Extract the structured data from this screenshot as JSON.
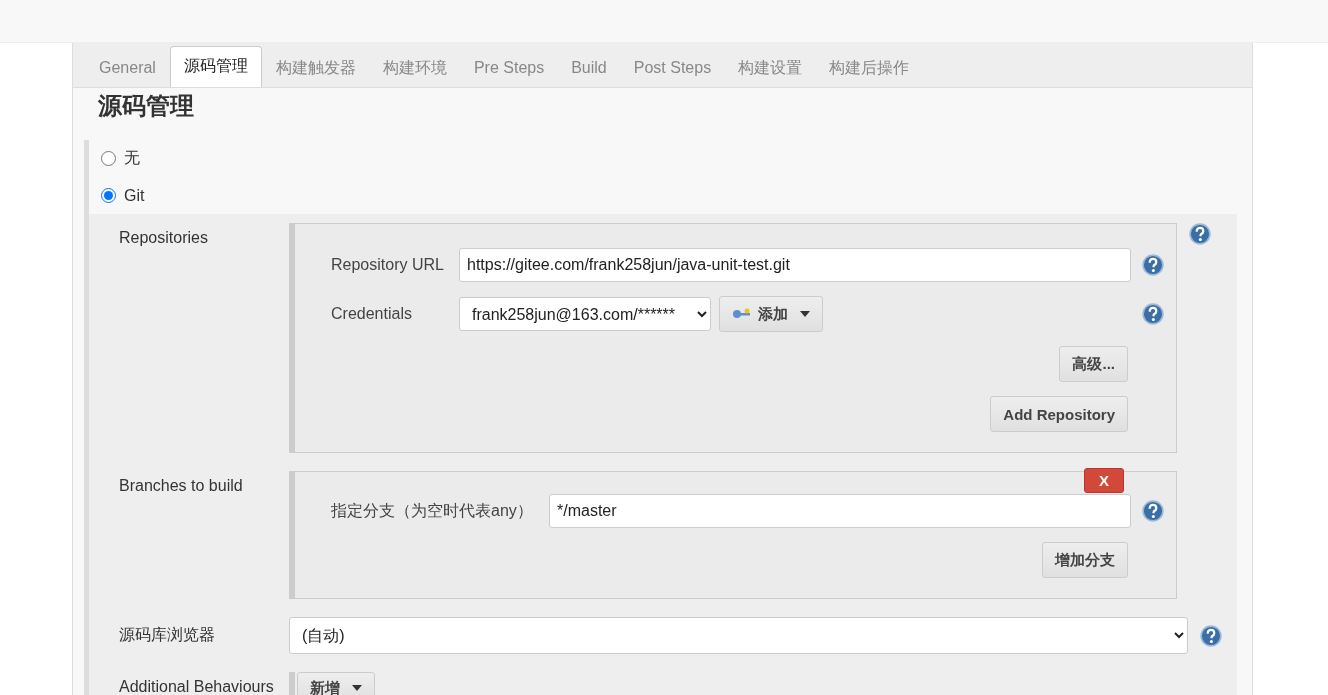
{
  "tabs": [
    {
      "label": "General",
      "selected": false
    },
    {
      "label": "源码管理",
      "selected": true
    },
    {
      "label": "构建触发器",
      "selected": false
    },
    {
      "label": "构建环境",
      "selected": false
    },
    {
      "label": "Pre Steps",
      "selected": false
    },
    {
      "label": "Build",
      "selected": false
    },
    {
      "label": "Post Steps",
      "selected": false
    },
    {
      "label": "构建设置",
      "selected": false
    },
    {
      "label": "构建后操作",
      "selected": false
    }
  ],
  "section_title": "源码管理",
  "scm_options": [
    {
      "label": "无",
      "selected": false
    },
    {
      "label": "Git",
      "selected": true
    }
  ],
  "repositories": {
    "label": "Repositories",
    "url_label": "Repository URL",
    "url_value": "https://gitee.com/frank258jun/java-unit-test.git",
    "credentials_label": "Credentials",
    "credentials_value": "frank258jun@163.com/******",
    "add_button": "添加",
    "advanced_button": "高级...",
    "add_repository_button": "Add Repository"
  },
  "branches": {
    "label": "Branches to build",
    "delete_button": "X",
    "branch_label": "指定分支（为空时代表any）",
    "branch_value": "*/master",
    "add_branch_button": "增加分支"
  },
  "browser": {
    "label": "源码库浏览器",
    "value": "(自动)"
  },
  "additional_behaviours": {
    "label": "Additional Behaviours",
    "add_button": "新增"
  }
}
